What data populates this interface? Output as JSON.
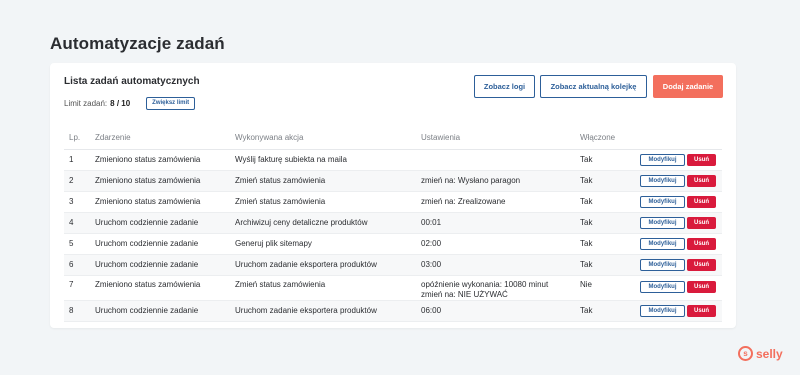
{
  "page": {
    "title": "Automatyzacje zadań"
  },
  "card": {
    "title": "Lista zadań automatycznych",
    "limit_label": "Limit zadań:",
    "limit_value": "8 / 10",
    "increase_limit": "Zwiększ limit"
  },
  "buttons": {
    "logs": "Zobacz logi",
    "queue": "Zobacz aktualną kolejkę",
    "add": "Dodaj zadanie"
  },
  "table": {
    "headers": [
      "Lp.",
      "Zdarzenie",
      "Wykonywana akcja",
      "Ustawienia",
      "Włączone"
    ],
    "rows": [
      {
        "lp": "1",
        "event": "Zmieniono status zamówienia",
        "action": "Wyślij fakturę subiekta na maila",
        "settings": "",
        "settings2": "",
        "enabled": "Tak"
      },
      {
        "lp": "2",
        "event": "Zmieniono status zamówienia",
        "action": "Zmień status zamówienia",
        "settings": "zmień na: Wysłano paragon",
        "settings2": "",
        "enabled": "Tak"
      },
      {
        "lp": "3",
        "event": "Zmieniono status zamówienia",
        "action": "Zmień status zamówienia",
        "settings": "zmień na: Zrealizowane",
        "settings2": "",
        "enabled": "Tak"
      },
      {
        "lp": "4",
        "event": "Uruchom codziennie zadanie",
        "action": "Archiwizuj ceny detaliczne produktów",
        "settings": "00:01",
        "settings2": "",
        "enabled": "Tak"
      },
      {
        "lp": "5",
        "event": "Uruchom codziennie zadanie",
        "action": "Generuj plik sitemapy",
        "settings": "02:00",
        "settings2": "",
        "enabled": "Tak"
      },
      {
        "lp": "6",
        "event": "Uruchom codziennie zadanie",
        "action": "Uruchom zadanie eksportera produktów",
        "settings": "03:00",
        "settings2": "",
        "enabled": "Tak"
      },
      {
        "lp": "7",
        "event": "Zmieniono status zamówienia",
        "action": "Zmień status zamówienia",
        "settings": "opóźnienie wykonania: 10080 minut",
        "settings2": "zmień na: NIE UŻYWAĆ",
        "enabled": "Nie"
      },
      {
        "lp": "8",
        "event": "Uruchom codziennie zadanie",
        "action": "Uruchom zadanie eksportera produktów",
        "settings": "06:00",
        "settings2": "",
        "enabled": "Tak"
      }
    ],
    "modify_label": "Modyfikuj",
    "delete_label": "Usuń"
  },
  "logo": {
    "icon": "selly-logo-icon",
    "glyph": "s",
    "text": "selly"
  },
  "colors": {
    "primary": "#2d5f99",
    "accent": "#f36f5d",
    "danger": "#d91a3c",
    "background": "#f2f5f7"
  }
}
